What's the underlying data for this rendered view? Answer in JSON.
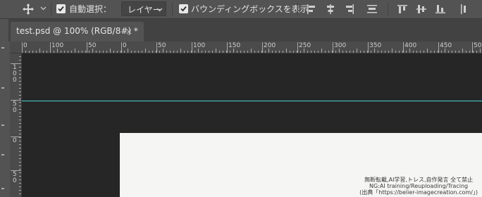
{
  "options_bar": {
    "auto_select_label": "自動選択：",
    "auto_select_checked": true,
    "auto_select_target": "レイヤー",
    "bounding_box_label": "バウンディングボックスを表示",
    "bounding_box_checked": true
  },
  "document_tab": {
    "title": "test.psd @ 100% (RGB/8#) *",
    "close_glyph": "×"
  },
  "ruler": {
    "h_labels": [
      "0",
      "100",
      "50",
      "0",
      "50",
      "100",
      "150",
      "200",
      "250",
      "300",
      "350",
      "400",
      "450",
      "500"
    ],
    "v_labels": [
      "100",
      "50",
      "0",
      "50"
    ]
  },
  "colors": {
    "guide": "#49d1d8",
    "canvas_bg": "#262626",
    "document_bg": "#f5f5f3",
    "ui_panel": "#535353"
  },
  "watermark": {
    "line1": "無断転載,AI学習,トレス,自作発言 全て禁止",
    "line2": "NG:AI training/Reuploading/Tracing",
    "line3": "(出典「https://belier-imagecreation.com/」)"
  }
}
